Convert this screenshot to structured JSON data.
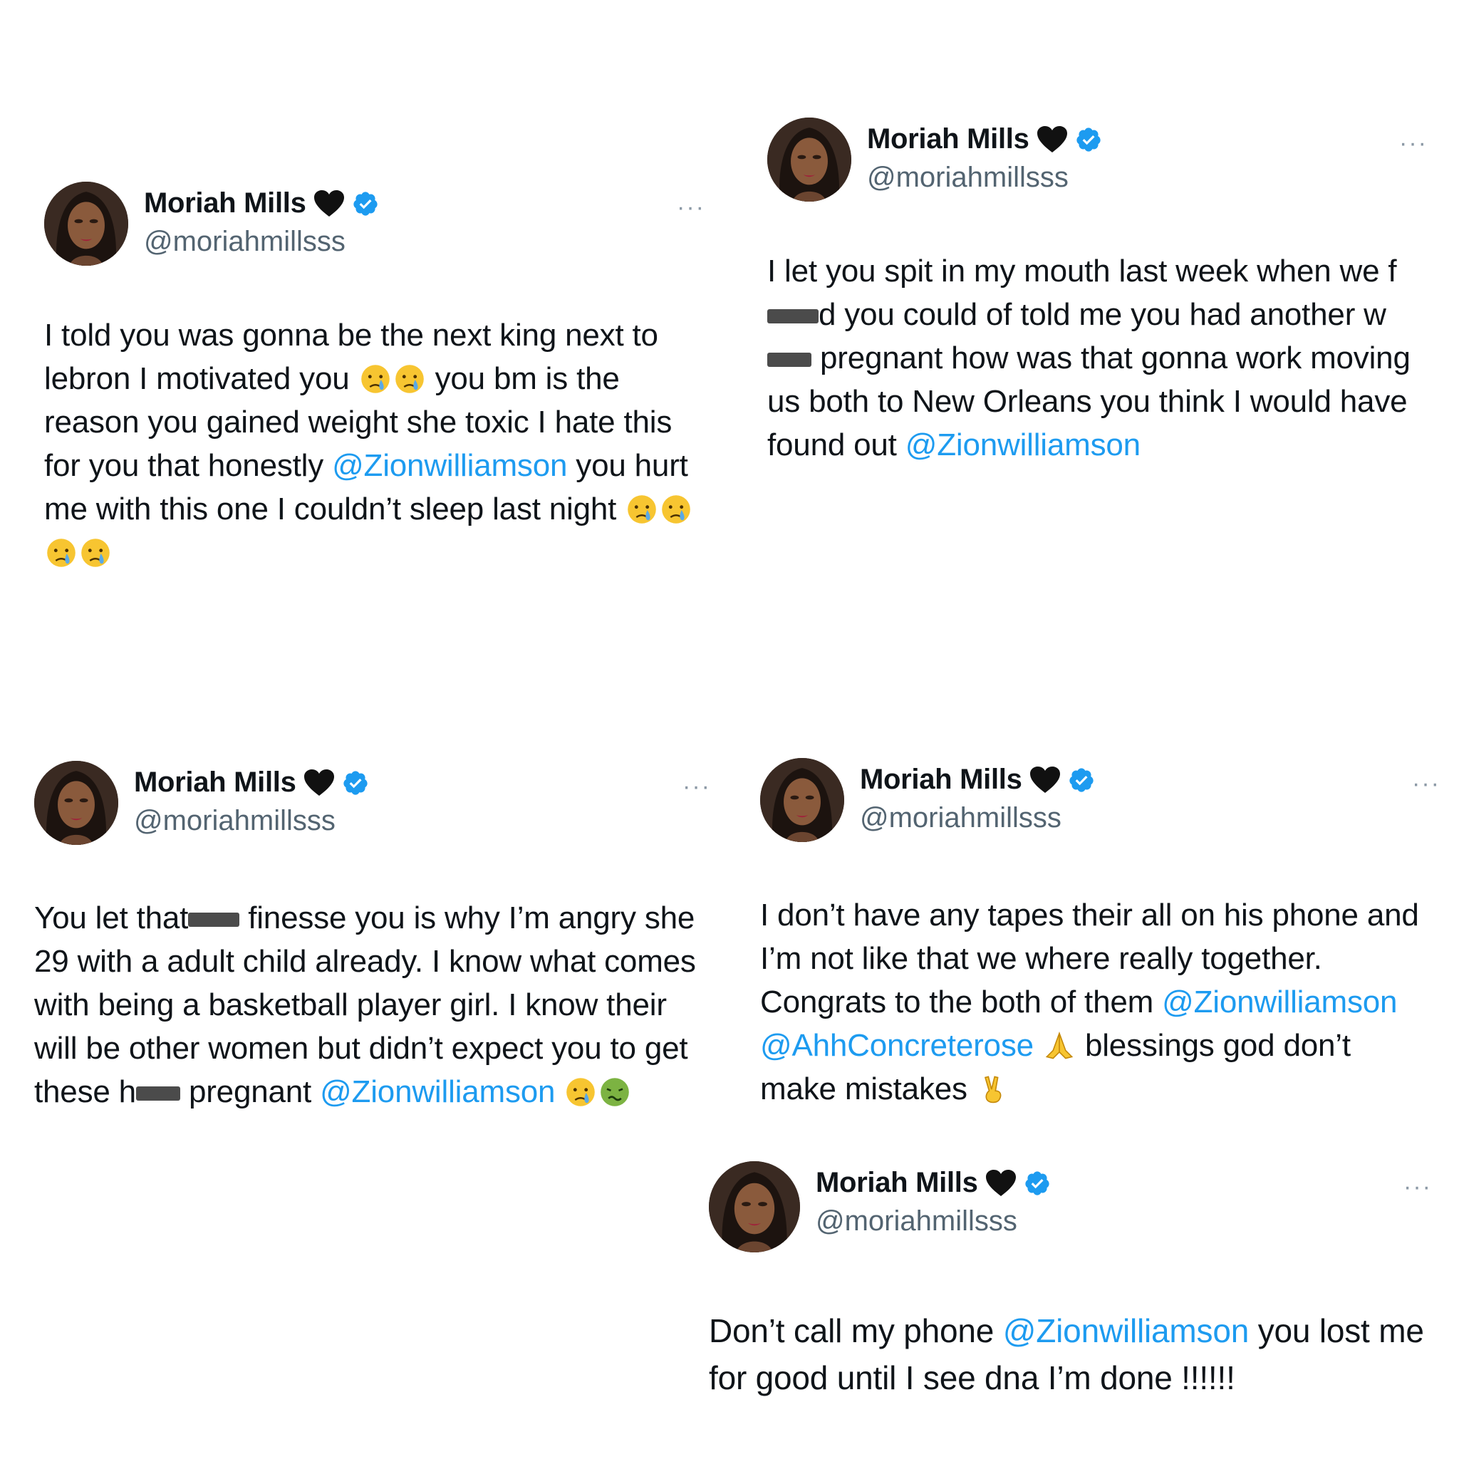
{
  "author": {
    "name": "Moriah Mills",
    "handle": "@moriahmillsss",
    "heart_emoji": "black-heart-icon",
    "verified": "verified-badge-icon"
  },
  "colors": {
    "mention": "#1d9bf0",
    "handle": "#536471",
    "verified": "#1d9bf0"
  },
  "more_label": "···",
  "tweets": [
    {
      "id": "t1",
      "parts": [
        {
          "t": "I told you was gonna be the next king next to lebron I motivated you "
        },
        {
          "e": "crying-face"
        },
        {
          "e": "crying-face"
        },
        {
          "t": " you bm is the reason you gained weight she toxic I hate this for you that honestly "
        },
        {
          "m": "@Zionwilliamson"
        },
        {
          "t": " you hurt me with this one I couldn’t sleep last night "
        },
        {
          "e": "crying-face"
        },
        {
          "e": "crying-face"
        },
        {
          "e": "crying-face"
        },
        {
          "e": "crying-face"
        }
      ]
    },
    {
      "id": "t2",
      "parts": [
        {
          "t": "I let you spit in my mouth last week when we f"
        },
        {
          "r": "redacted"
        },
        {
          "t": "d you could of told me you had another w"
        },
        {
          "r": "redacted"
        },
        {
          "t": " pregnant how was that gonna work moving us both to New Orleans you think I would have found out "
        },
        {
          "m": "@Zionwilliamson"
        }
      ]
    },
    {
      "id": "t3",
      "parts": [
        {
          "t": "You let that"
        },
        {
          "r": "redacted"
        },
        {
          "t": " finesse you is why I’m angry she 29 with a adult child already. I know what comes with being a basketball player girl. I know their will be other women but didn’t expect you to get these h"
        },
        {
          "r": "redacted"
        },
        {
          "t": " pregnant "
        },
        {
          "m": "@Zionwilliamson"
        },
        {
          "t": " "
        },
        {
          "e": "crying-face"
        },
        {
          "e": "nauseated-face"
        }
      ]
    },
    {
      "id": "t4",
      "parts": [
        {
          "t": "I don’t have any tapes their all on his phone and I’m not like that we where really together. Congrats to the both of them "
        },
        {
          "m": "@Zionwilliamson"
        },
        {
          "t": " "
        },
        {
          "m": "@AhhConcreterose"
        },
        {
          "t": " "
        },
        {
          "e": "folded-hands"
        },
        {
          "t": " blessings god don’t make mistakes "
        },
        {
          "e": "victory-hand"
        }
      ]
    },
    {
      "id": "t5",
      "parts": [
        {
          "t": "Don’t call my phone "
        },
        {
          "m": "@Zionwilliamson"
        },
        {
          "t": " you lost me for good until I see dna I’m done !!!!!!"
        }
      ]
    }
  ]
}
